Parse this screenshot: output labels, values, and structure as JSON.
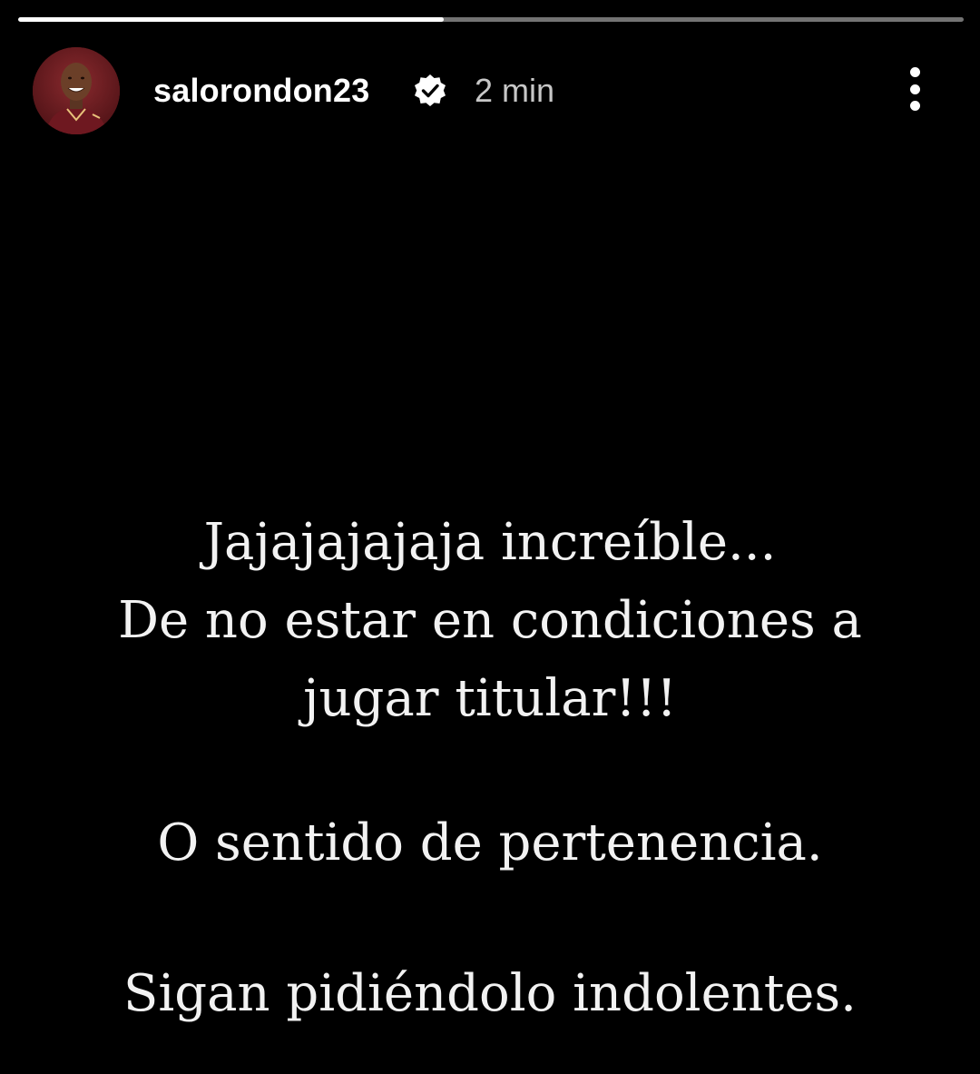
{
  "story": {
    "progress_fraction": 0.45,
    "username": "salorondon23",
    "verified": true,
    "time_ago": "2 min",
    "paragraphs": [
      [
        "Jajajajajaja increíble...",
        "De no estar en condiciones a",
        "jugar titular!!!"
      ],
      [
        "O sentido de pertenencia."
      ],
      [
        "Sigan pidiéndolo indolentes."
      ]
    ]
  },
  "icons": {
    "verified": "verified-badge-icon",
    "menu": "more-options-icon"
  },
  "colors": {
    "background": "#000000",
    "text": "#f2f2f2",
    "time": "#c7c7c7",
    "progress_track": "rgba(255,255,255,0.45)",
    "progress_fill": "#ffffff",
    "avatar_bg": "#6a1a1f"
  }
}
